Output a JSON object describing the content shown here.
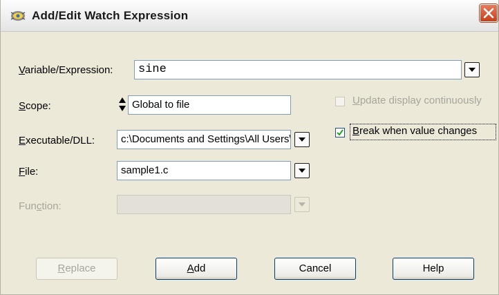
{
  "window": {
    "title": "Add/Edit Watch Expression",
    "icon": "cvi-debug-icon",
    "close_icon": "close-icon"
  },
  "form": {
    "variable": {
      "label_underlined": "V",
      "label_rest": "ariable/Expression:",
      "value": "sine"
    },
    "scope": {
      "label_underlined": "S",
      "label_rest": "cope:",
      "value": "Global to file"
    },
    "executable": {
      "label_underlined": "E",
      "label_rest": "xecutable/DLL:",
      "value": "c:\\Documents and Settings\\All Users\\"
    },
    "file": {
      "label_underlined": "F",
      "label_rest": "ile:",
      "value": "sample1.c"
    },
    "function": {
      "label_before": "Fun",
      "label_underlined": "c",
      "label_after": "tion:",
      "value": ""
    }
  },
  "options": {
    "update_display": {
      "label_underlined": "U",
      "label_rest": "pdate display continuously",
      "checked": false,
      "enabled": false
    },
    "break_on_change": {
      "label_underlined": "B",
      "label_rest": "reak when value changes",
      "checked": true,
      "enabled": true
    }
  },
  "buttons": {
    "replace": {
      "label_underlined": "R",
      "label_rest": "eplace",
      "enabled": false
    },
    "add": {
      "label_underlined": "A",
      "label_rest": "dd",
      "enabled": true
    },
    "cancel": {
      "label": "Cancel",
      "enabled": true
    },
    "help": {
      "label": "Help",
      "enabled": true
    }
  },
  "colors": {
    "dialog_bg": "#ece9d8",
    "field_border": "#7f9db9",
    "checkmark": "#21a121",
    "close_button": "#d5552f",
    "disabled_text": "#a7a59c"
  }
}
